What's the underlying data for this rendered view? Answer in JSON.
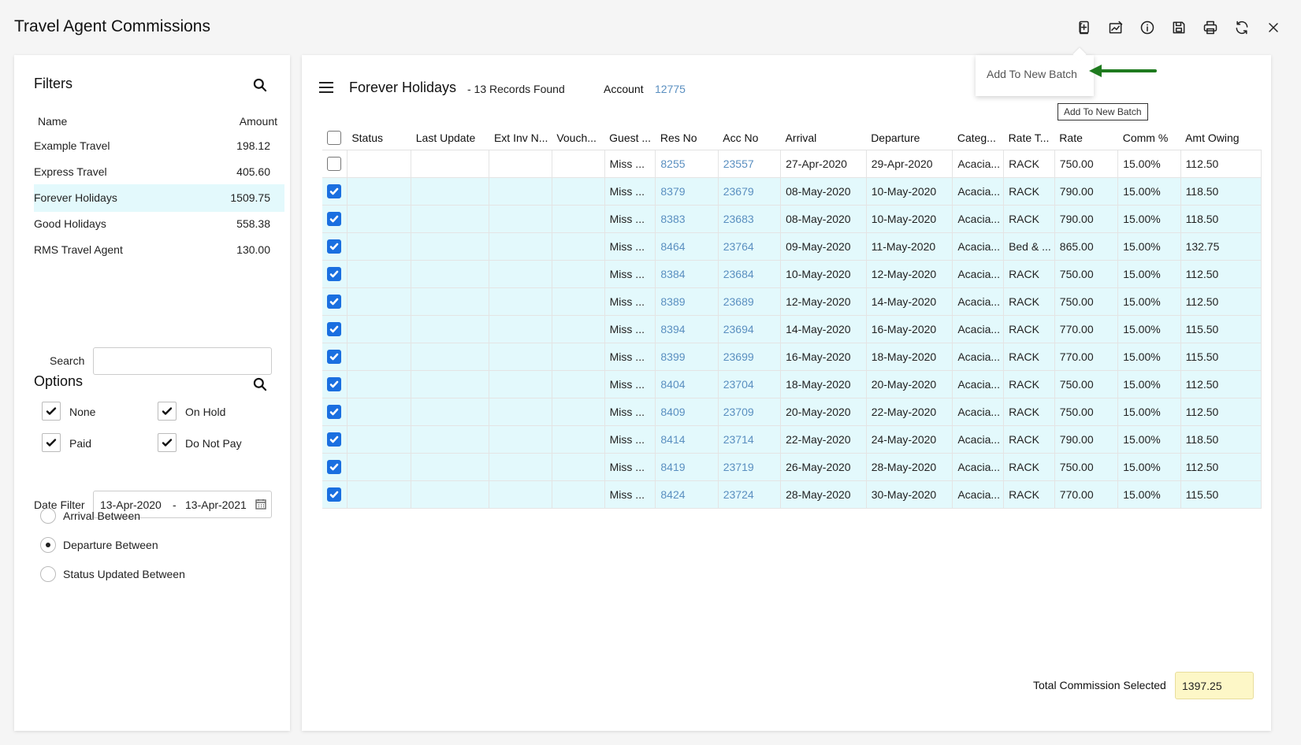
{
  "app_title": "Travel Agent Commissions",
  "toolbar": {
    "icons": [
      "add-batch-icon",
      "edit-report-icon",
      "info-icon",
      "save-icon",
      "print-icon",
      "refresh-icon",
      "close-icon"
    ]
  },
  "popup": {
    "item": "Add To New Batch"
  },
  "tooltip": "Add To New Batch",
  "filters": {
    "title": "Filters",
    "col_name": "Name",
    "col_amount": "Amount",
    "agents": [
      {
        "name": "Example Travel",
        "amount": "198.12"
      },
      {
        "name": "Express Travel",
        "amount": "405.60"
      },
      {
        "name": "Forever Holidays",
        "amount": "1509.75"
      },
      {
        "name": "Good Holidays",
        "amount": "558.38"
      },
      {
        "name": "RMS Travel Agent",
        "amount": "130.00"
      }
    ],
    "selected_agent": "Forever Holidays",
    "search_label": "Search",
    "search_value": ""
  },
  "options": {
    "title": "Options",
    "none": "None",
    "on_hold": "On Hold",
    "paid": "Paid",
    "do_not_pay": "Do Not Pay",
    "none_checked": true,
    "on_hold_checked": true,
    "paid_checked": true,
    "do_not_pay_checked": true
  },
  "date_filter": {
    "label": "Date Filter",
    "from": "13-Apr-2020",
    "separator": "-",
    "to": "13-Apr-2021"
  },
  "date_modes": [
    {
      "label": "Arrival Between",
      "selected": false
    },
    {
      "label": "Departure Between",
      "selected": true
    },
    {
      "label": "Status Updated Between",
      "selected": false
    }
  ],
  "main": {
    "title": "Forever Holidays",
    "record_count": "- 13 Records Found",
    "account_label": "Account",
    "account_value": "12775"
  },
  "table": {
    "columns": [
      "Status",
      "Last Update",
      "Ext Inv N...",
      "Vouch...",
      "Guest ...",
      "Res No",
      "Acc No",
      "Arrival",
      "Departure",
      "Categ...",
      "Rate T...",
      "Rate",
      "Comm %",
      "Amt Owing"
    ],
    "rows": [
      {
        "checked": false,
        "status": "",
        "last_update": "",
        "ext_inv": "",
        "voucher": "",
        "guest": "Miss ...",
        "res_no": "8255",
        "acc_no": "23557",
        "arrival": "27-Apr-2020",
        "departure": "29-Apr-2020",
        "category": "Acacia...",
        "rate_type": "RACK",
        "rate": "750.00",
        "comm": "15.00%",
        "amt_owing": "112.50"
      },
      {
        "checked": true,
        "status": "",
        "last_update": "",
        "ext_inv": "",
        "voucher": "",
        "guest": "Miss ...",
        "res_no": "8379",
        "acc_no": "23679",
        "arrival": "08-May-2020",
        "departure": "10-May-2020",
        "category": "Acacia...",
        "rate_type": "RACK",
        "rate": "790.00",
        "comm": "15.00%",
        "amt_owing": "118.50"
      },
      {
        "checked": true,
        "status": "",
        "last_update": "",
        "ext_inv": "",
        "voucher": "",
        "guest": "Miss ...",
        "res_no": "8383",
        "acc_no": "23683",
        "arrival": "08-May-2020",
        "departure": "10-May-2020",
        "category": "Acacia...",
        "rate_type": "RACK",
        "rate": "790.00",
        "comm": "15.00%",
        "amt_owing": "118.50"
      },
      {
        "checked": true,
        "status": "",
        "last_update": "",
        "ext_inv": "",
        "voucher": "",
        "guest": "Miss ...",
        "res_no": "8464",
        "acc_no": "23764",
        "arrival": "09-May-2020",
        "departure": "11-May-2020",
        "category": "Acacia...",
        "rate_type": "Bed & ...",
        "rate": "865.00",
        "comm": "15.00%",
        "amt_owing": "132.75"
      },
      {
        "checked": true,
        "status": "",
        "last_update": "",
        "ext_inv": "",
        "voucher": "",
        "guest": "Miss ...",
        "res_no": "8384",
        "acc_no": "23684",
        "arrival": "10-May-2020",
        "departure": "12-May-2020",
        "category": "Acacia...",
        "rate_type": "RACK",
        "rate": "750.00",
        "comm": "15.00%",
        "amt_owing": "112.50"
      },
      {
        "checked": true,
        "status": "",
        "last_update": "",
        "ext_inv": "",
        "voucher": "",
        "guest": "Miss ...",
        "res_no": "8389",
        "acc_no": "23689",
        "arrival": "12-May-2020",
        "departure": "14-May-2020",
        "category": "Acacia...",
        "rate_type": "RACK",
        "rate": "750.00",
        "comm": "15.00%",
        "amt_owing": "112.50"
      },
      {
        "checked": true,
        "status": "",
        "last_update": "",
        "ext_inv": "",
        "voucher": "",
        "guest": "Miss ...",
        "res_no": "8394",
        "acc_no": "23694",
        "arrival": "14-May-2020",
        "departure": "16-May-2020",
        "category": "Acacia...",
        "rate_type": "RACK",
        "rate": "770.00",
        "comm": "15.00%",
        "amt_owing": "115.50"
      },
      {
        "checked": true,
        "status": "",
        "last_update": "",
        "ext_inv": "",
        "voucher": "",
        "guest": "Miss ...",
        "res_no": "8399",
        "acc_no": "23699",
        "arrival": "16-May-2020",
        "departure": "18-May-2020",
        "category": "Acacia...",
        "rate_type": "RACK",
        "rate": "770.00",
        "comm": "15.00%",
        "amt_owing": "115.50"
      },
      {
        "checked": true,
        "status": "",
        "last_update": "",
        "ext_inv": "",
        "voucher": "",
        "guest": "Miss ...",
        "res_no": "8404",
        "acc_no": "23704",
        "arrival": "18-May-2020",
        "departure": "20-May-2020",
        "category": "Acacia...",
        "rate_type": "RACK",
        "rate": "750.00",
        "comm": "15.00%",
        "amt_owing": "112.50"
      },
      {
        "checked": true,
        "status": "",
        "last_update": "",
        "ext_inv": "",
        "voucher": "",
        "guest": "Miss ...",
        "res_no": "8409",
        "acc_no": "23709",
        "arrival": "20-May-2020",
        "departure": "22-May-2020",
        "category": "Acacia...",
        "rate_type": "RACK",
        "rate": "750.00",
        "comm": "15.00%",
        "amt_owing": "112.50"
      },
      {
        "checked": true,
        "status": "",
        "last_update": "",
        "ext_inv": "",
        "voucher": "",
        "guest": "Miss ...",
        "res_no": "8414",
        "acc_no": "23714",
        "arrival": "22-May-2020",
        "departure": "24-May-2020",
        "category": "Acacia...",
        "rate_type": "RACK",
        "rate": "790.00",
        "comm": "15.00%",
        "amt_owing": "118.50"
      },
      {
        "checked": true,
        "status": "",
        "last_update": "",
        "ext_inv": "",
        "voucher": "",
        "guest": "Miss ...",
        "res_no": "8419",
        "acc_no": "23719",
        "arrival": "26-May-2020",
        "departure": "28-May-2020",
        "category": "Acacia...",
        "rate_type": "RACK",
        "rate": "750.00",
        "comm": "15.00%",
        "amt_owing": "112.50"
      },
      {
        "checked": true,
        "status": "",
        "last_update": "",
        "ext_inv": "",
        "voucher": "",
        "guest": "Miss ...",
        "res_no": "8424",
        "acc_no": "23724",
        "arrival": "28-May-2020",
        "departure": "30-May-2020",
        "category": "Acacia...",
        "rate_type": "RACK",
        "rate": "770.00",
        "comm": "15.00%",
        "amt_owing": "115.50"
      }
    ]
  },
  "total": {
    "label": "Total Commission Selected",
    "value": "1397.25"
  },
  "colors": {
    "selected_row": "#e3f9fc",
    "link": "#5a8fc0",
    "checkbox": "#1a6fe0",
    "annotation_arrow": "#1e7a1e",
    "total_field": "#fdf7c7"
  }
}
